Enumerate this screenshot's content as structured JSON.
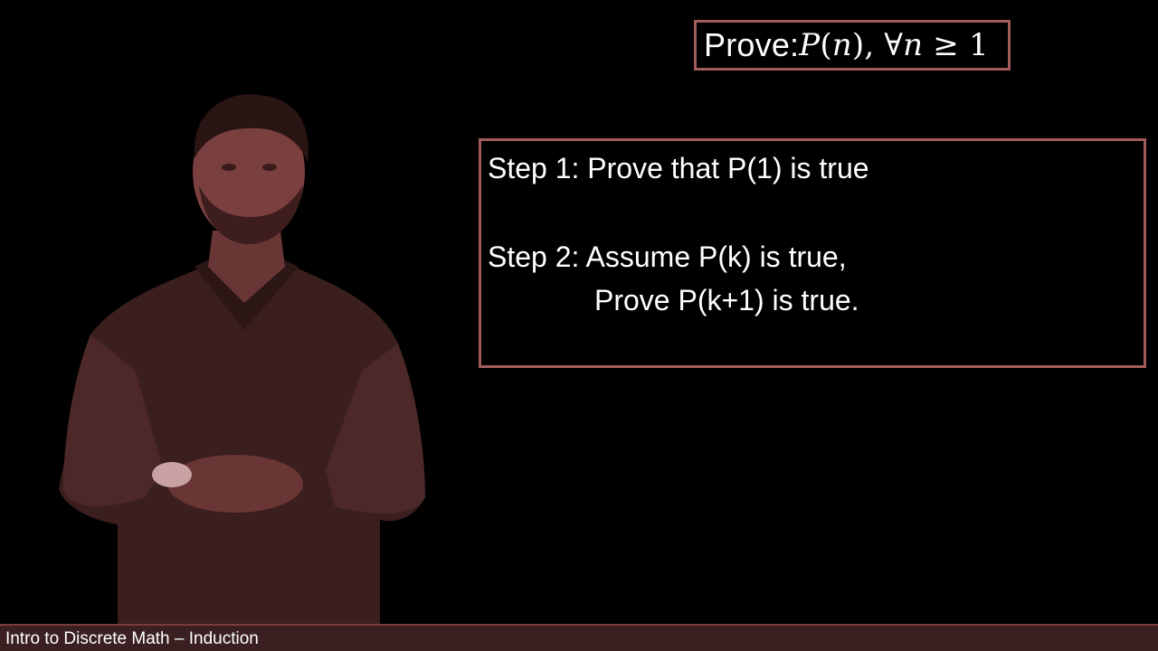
{
  "prove": {
    "label": "Prove: ",
    "p": "P",
    "open": "(",
    "n": "n",
    "close": ")",
    "sep": ", ",
    "forall": "∀",
    "var": "n",
    "geq": " ≥ ",
    "bound": "1"
  },
  "steps": {
    "step1": "Step 1: Prove that P(1) is true",
    "step2_line1": "Step 2: Assume P(k) is true,",
    "step2_line2": "Prove P(k+1) is true."
  },
  "footer": {
    "title": "Intro to Discrete Math – Induction"
  },
  "colors": {
    "background": "#000000",
    "box_border": "#a35c5c",
    "presenter_tint": "#7a3f3f",
    "footer_bar": "#3a2020"
  }
}
